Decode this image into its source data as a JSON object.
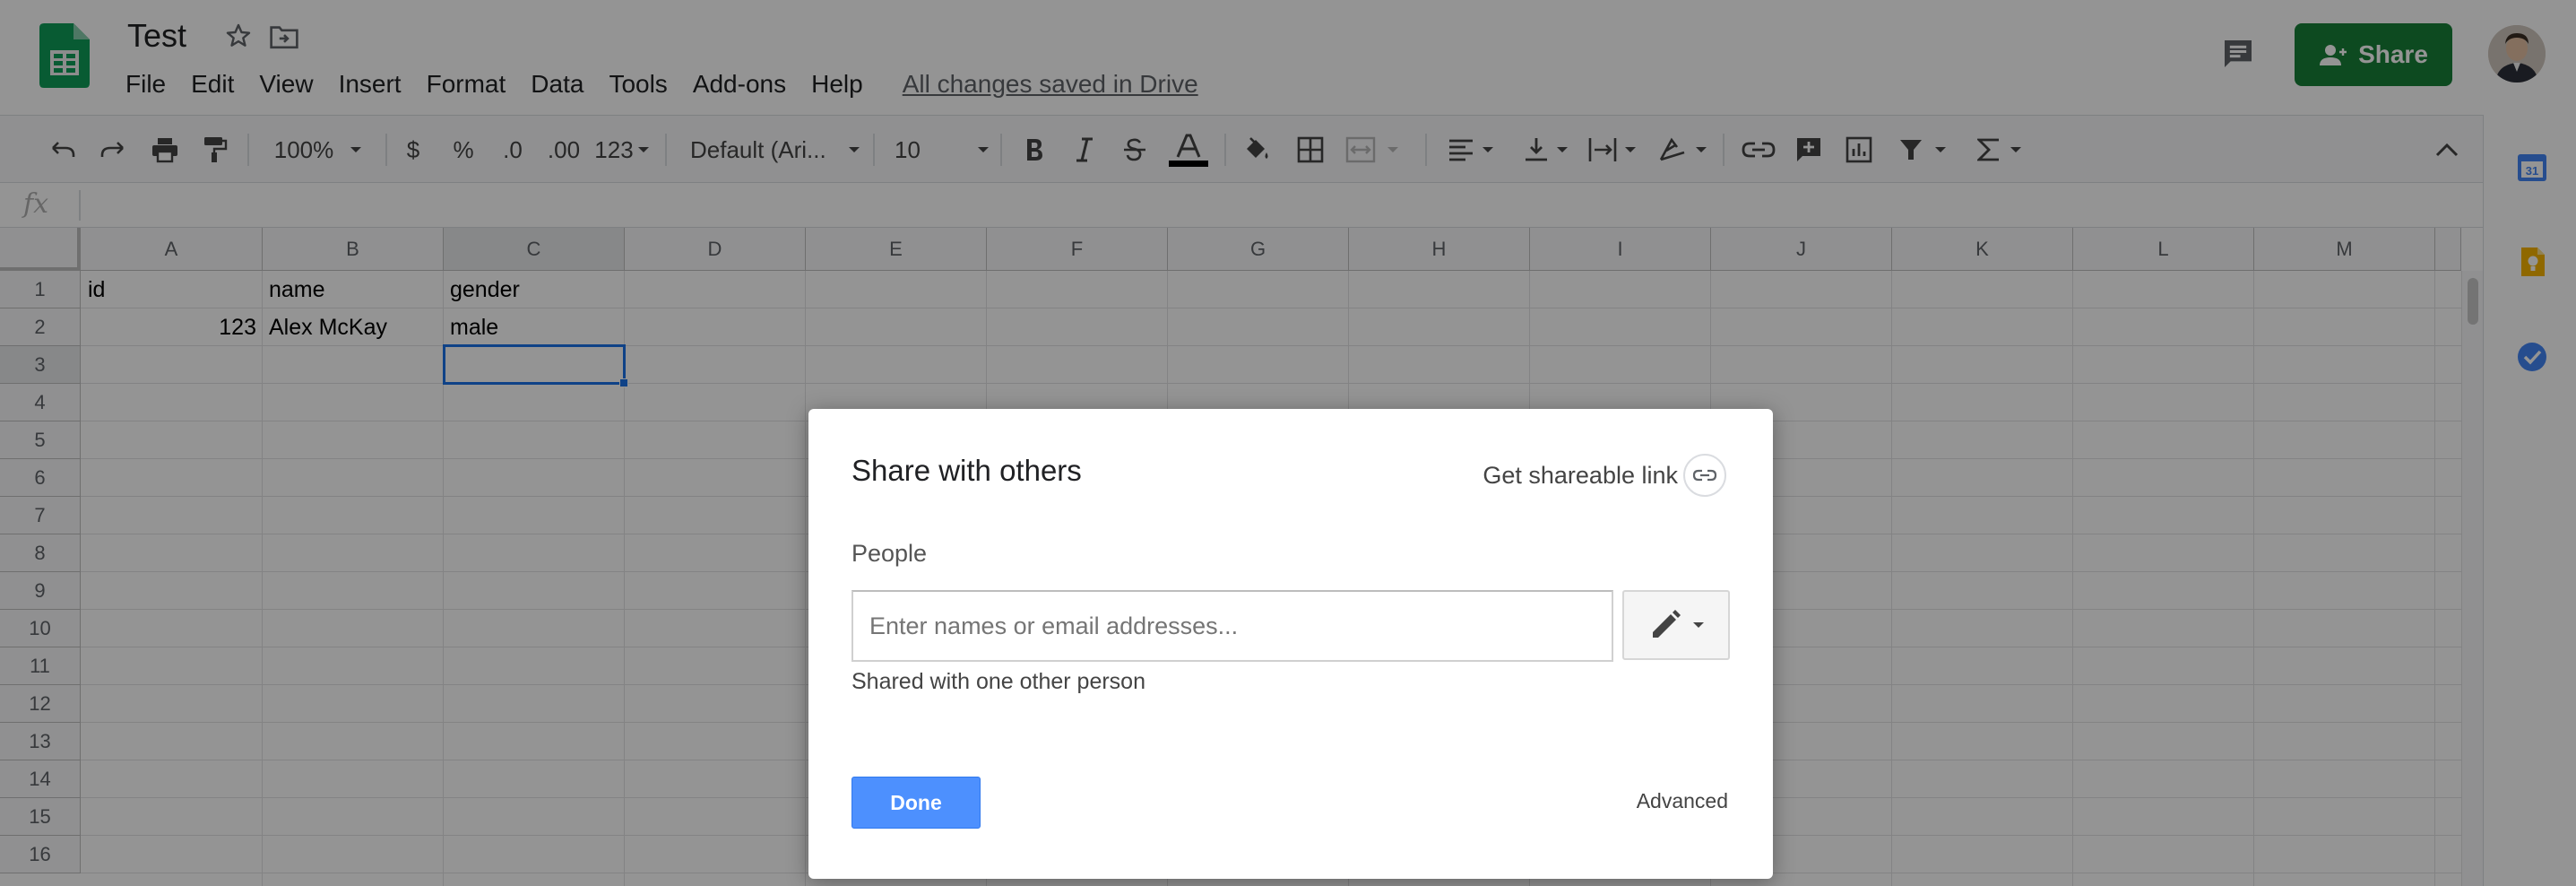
{
  "header": {
    "doc_title": "Test",
    "menu": [
      "File",
      "Edit",
      "View",
      "Insert",
      "Format",
      "Data",
      "Tools",
      "Add-ons",
      "Help"
    ],
    "save_status": "All changes saved in Drive",
    "share_label": "Share",
    "share_color": "#188038"
  },
  "toolbar": {
    "zoom": "100%",
    "currency": "$",
    "percent": "%",
    "decrease_decimal": ".0",
    "increase_decimal": ".00",
    "more_formats": "123",
    "font": "Default (Ari...",
    "font_size": "10"
  },
  "formula_bar": {
    "fx": "fx"
  },
  "grid": {
    "columns": [
      "A",
      "B",
      "C",
      "D",
      "E",
      "F",
      "G",
      "H",
      "I",
      "J",
      "K",
      "L",
      "M"
    ],
    "rows": [
      "1",
      "2",
      "3",
      "4",
      "5",
      "6",
      "7",
      "8",
      "9",
      "10",
      "11",
      "12",
      "13",
      "14",
      "15",
      "16"
    ],
    "cells": {
      "A1": "id",
      "B1": "name",
      "C1": "gender",
      "A2": "123",
      "B2": "Alex McKay",
      "C2": "male"
    },
    "selected_cell": "C3"
  },
  "side_panel": {
    "calendar_day": "31"
  },
  "dialog": {
    "title": "Share with others",
    "shareable_link": "Get shareable link",
    "people_label": "People",
    "people_placeholder": "Enter names or email addresses...",
    "shared_with": "Shared with one other person",
    "done_label": "Done",
    "advanced_label": "Advanced",
    "done_color": "#4d90fe"
  },
  "icons": [
    "sheets-logo-icon",
    "star-icon",
    "move-to-folder-icon",
    "comment-icon",
    "share-person-icon",
    "undo-icon",
    "redo-icon",
    "print-icon",
    "paint-format-icon",
    "bold-icon",
    "italic-icon",
    "strikethrough-icon",
    "text-color-icon",
    "fill-color-icon",
    "borders-icon",
    "merge-cells-icon",
    "align-horizontal-icon",
    "align-vertical-icon",
    "text-wrap-icon",
    "text-rotate-icon",
    "link-icon",
    "insert-comment-icon",
    "insert-chart-icon",
    "filter-icon",
    "functions-icon",
    "collapse-chevron-icon",
    "calendar-icon",
    "keep-icon",
    "tasks-icon",
    "edit-pencil-icon",
    "link-chain-icon"
  ]
}
